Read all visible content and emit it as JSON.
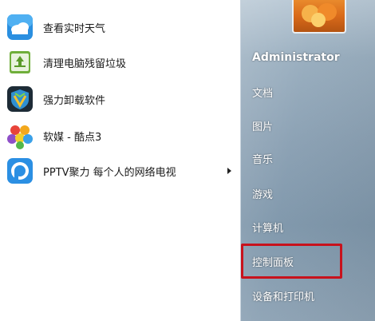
{
  "left_pane": {
    "items": [
      {
        "label": "查看实时天气",
        "icon": "weather-icon"
      },
      {
        "label": "清理电脑残留垃圾",
        "icon": "recycle-bin-icon"
      },
      {
        "label": "强力卸载软件",
        "icon": "uninstall-shield-icon"
      },
      {
        "label": "软媒 - 酷点3",
        "icon": "kudian-flower-icon"
      },
      {
        "label": "PPTV聚力 每个人的网络电视",
        "icon": "pptv-icon",
        "has_submenu": true
      }
    ]
  },
  "right_pane": {
    "user": "Administrator",
    "links": [
      "文档",
      "图片",
      "音乐",
      "游戏",
      "计算机",
      "控制面板",
      "设备和打印机"
    ],
    "highlighted": "控制面板",
    "highlight_color": "#c8121c"
  }
}
